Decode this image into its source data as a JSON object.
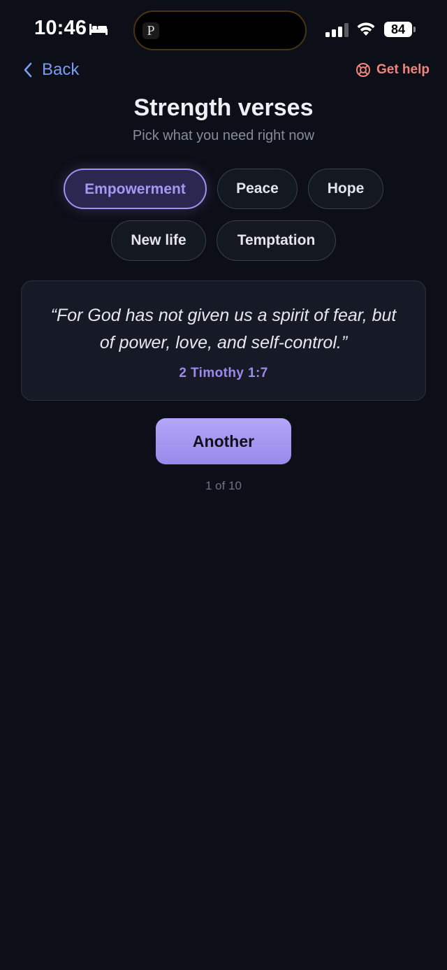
{
  "status_bar": {
    "time": "10:46",
    "battery": "84",
    "island_app_letter": "P"
  },
  "nav": {
    "back_label": "Back",
    "help_label": "Get help"
  },
  "header": {
    "title": "Strength verses",
    "subtitle": "Pick what you need right now"
  },
  "chips": [
    {
      "label": "Empowerment",
      "active": true
    },
    {
      "label": "Peace",
      "active": false
    },
    {
      "label": "Hope",
      "active": false
    },
    {
      "label": "New life",
      "active": false
    },
    {
      "label": "Temptation",
      "active": false
    }
  ],
  "verse": {
    "text": "“For God has not given us a spirit of fear, but of power, love, and self-control.”",
    "reference": "2 Timothy 1:7"
  },
  "another_button_label": "Another",
  "counter": "1 of 10",
  "colors": {
    "background": "#0c0f17",
    "accent": "#a191f0",
    "link": "#7a9cf5",
    "help": "#f2847c"
  }
}
